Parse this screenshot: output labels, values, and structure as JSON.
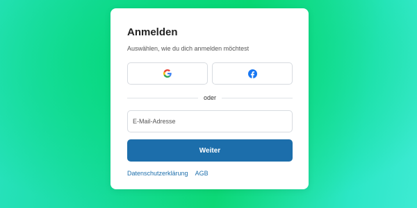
{
  "login": {
    "title": "Anmelden",
    "subtitle": "Auswählen, wie du dich anmelden möchtest",
    "social": [
      {
        "provider": "google",
        "icon": "google-icon"
      },
      {
        "provider": "facebook",
        "icon": "facebook-icon"
      }
    ],
    "divider_text": "oder",
    "email": {
      "value": "",
      "placeholder": "E-Mail-Adresse"
    },
    "submit_label": "Weiter",
    "links": [
      {
        "label": "Datenschutzerklärung"
      },
      {
        "label": "AGB"
      }
    ]
  },
  "colors": {
    "primary": "#1c6eab",
    "background_green": "#0ed877",
    "background_teal": "#2ae3c2",
    "facebook_blue": "#1877f2"
  }
}
